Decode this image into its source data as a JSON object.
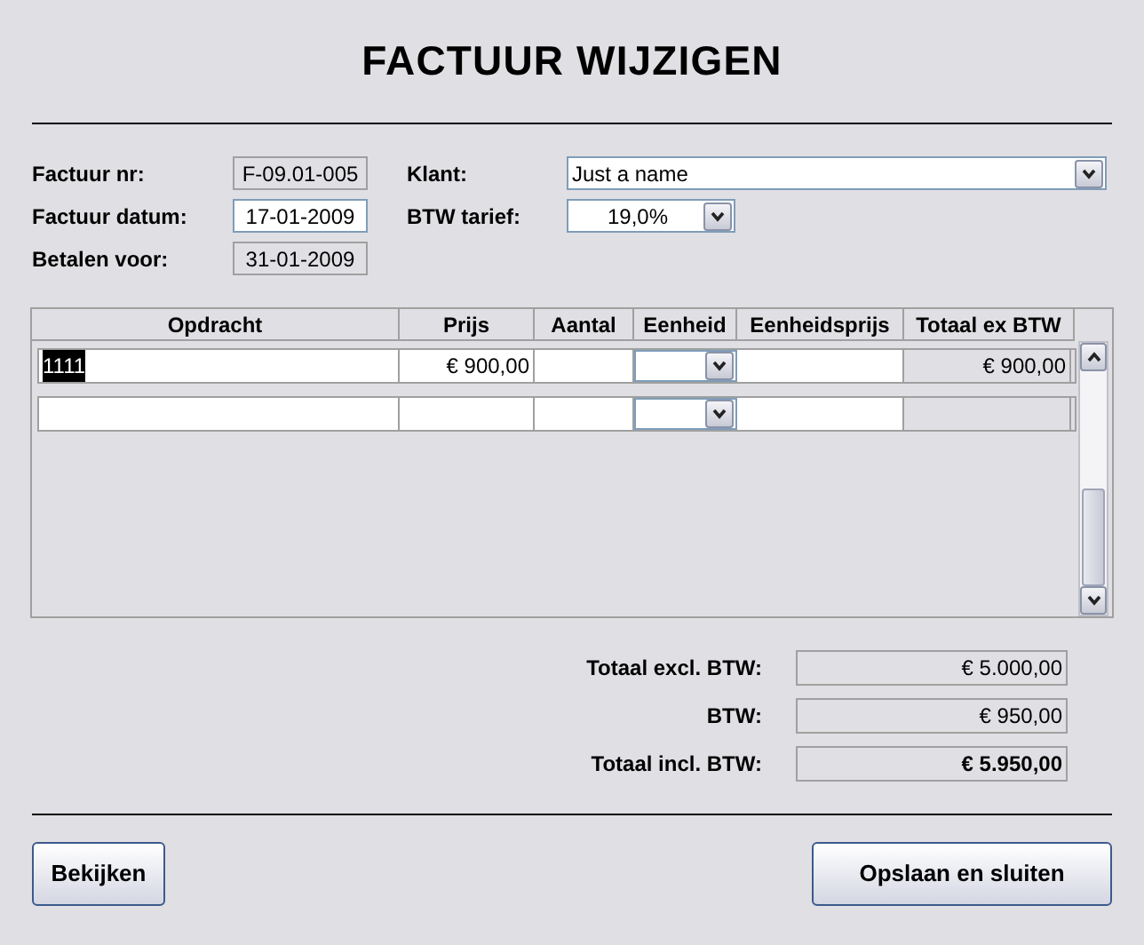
{
  "title": "FACTUUR WIJZIGEN",
  "fields": [
    {
      "label": "Factuur nr:",
      "value": "F-09.01-005",
      "editable": false
    },
    {
      "label": "Factuur datum:",
      "value": "17-01-2009",
      "editable": true
    },
    {
      "label": "Betalen voor:",
      "value": "31-01-2009",
      "editable": false
    }
  ],
  "klant": {
    "label": "Klant:",
    "value": "Just a name"
  },
  "btw_tarief": {
    "label": "BTW tarief:",
    "value": "19,0%"
  },
  "table": {
    "columns": [
      "Opdracht",
      "Prijs",
      "Aantal",
      "Eenheid",
      "Eenheidsprijs",
      "Totaal ex BTW"
    ],
    "rows": [
      {
        "opdracht": "1111",
        "text_selected": true,
        "prijs": "€ 900,00",
        "totaal": "€ 900,00"
      },
      {}
    ]
  },
  "totals": [
    {
      "label": "Totaal excl. BTW:",
      "value": "€ 5.000,00",
      "bold": false
    },
    {
      "label": "BTW:",
      "value": "€ 950,00",
      "bold": false
    },
    {
      "label": "Totaal incl. BTW:",
      "value": "€ 5.950,00",
      "bold": true
    }
  ],
  "buttons": [
    "Bekijken",
    "Opslaan en sluiten"
  ]
}
